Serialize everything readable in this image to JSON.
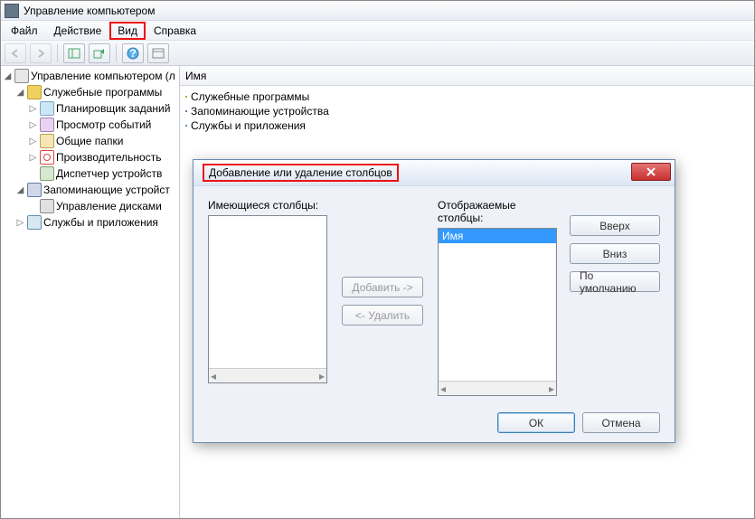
{
  "window": {
    "title": "Управление компьютером"
  },
  "menu": {
    "file": "Файл",
    "action": "Действие",
    "view": "Вид",
    "help": "Справка"
  },
  "tree": {
    "root": "Управление компьютером (л",
    "tools": "Служебные программы",
    "scheduler": "Планировщик заданий",
    "events": "Просмотр событий",
    "shared": "Общие папки",
    "perf": "Производительность",
    "devices": "Диспетчер устройств",
    "storage": "Запоминающие устройст",
    "disks": "Управление дисками",
    "services": "Службы и приложения"
  },
  "list": {
    "header": "Имя",
    "rows": [
      "Служебные программы",
      "Запоминающие устройства",
      "Службы и приложения"
    ]
  },
  "dialog": {
    "title": "Добавление или удаление столбцов",
    "available_label": "Имеющиеся столбцы:",
    "displayed_label": "Отображаемые столбцы:",
    "displayed_item": "Имя",
    "add": "Добавить ->",
    "remove": "<- Удалить",
    "up": "Вверх",
    "down": "Вниз",
    "defaults": "По умолчанию",
    "ok": "ОК",
    "cancel": "Отмена"
  }
}
